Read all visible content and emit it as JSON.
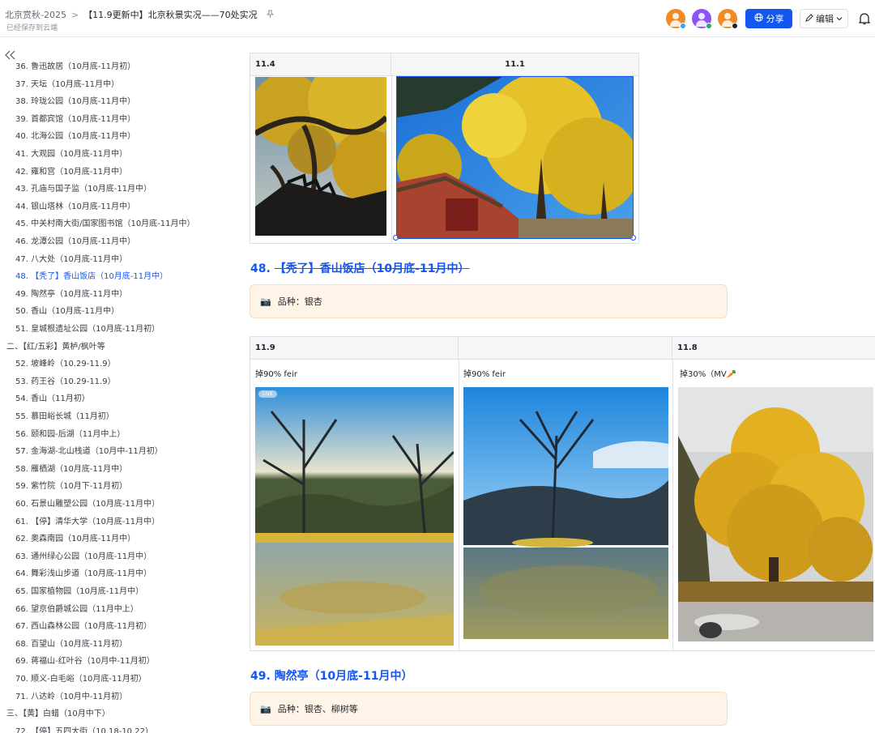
{
  "header": {
    "breadcrumb_root": "北京赏秋-2025",
    "breadcrumb_sep": ">",
    "doc_title": "【11.9更新中】北京秋景实况——70处实况",
    "save_status": "已经保存到云端",
    "share_label": "分享",
    "edit_label": "编辑",
    "avatar_colors": [
      "#f08a24",
      "#8d55f5",
      "#f08a24"
    ],
    "avatar_status_colors": [
      "#3aa1f2",
      "#26a869",
      "#1f2329"
    ],
    "accent": "#1456f0"
  },
  "sidebar": {
    "items": [
      {
        "label": "36. 鲁迅故居（10月底-11月初）",
        "indent": 1,
        "active": false
      },
      {
        "label": "37. 天坛（10月底-11月中）",
        "indent": 1,
        "active": false
      },
      {
        "label": "38. 玲珑公园（10月底-11月中）",
        "indent": 1,
        "active": false
      },
      {
        "label": "39. 首都宾馆（10月底-11月中）",
        "indent": 1,
        "active": false
      },
      {
        "label": "40. 北海公园（10月底-11月中）",
        "indent": 1,
        "active": false
      },
      {
        "label": "41. 大观园（10月底-11月中）",
        "indent": 1,
        "active": false
      },
      {
        "label": "42. 雍和宫（10月底-11月中）",
        "indent": 1,
        "active": false
      },
      {
        "label": "43. 孔庙与国子监（10月底-11月中）",
        "indent": 1,
        "active": false
      },
      {
        "label": "44. 银山塔林（10月底-11月中）",
        "indent": 1,
        "active": false
      },
      {
        "label": "45. 中关村南大街/国家图书馆（10月底-11月中）",
        "indent": 1,
        "active": false
      },
      {
        "label": "46. 龙潭公园（10月底-11月中）",
        "indent": 1,
        "active": false
      },
      {
        "label": "47. 八大处（10月底-11月中）",
        "indent": 1,
        "active": false
      },
      {
        "label": "48. 【秃了】香山饭店（10月底-11月中）",
        "indent": 1,
        "active": true
      },
      {
        "label": "49. 陶然亭（10月底-11月中）",
        "indent": 1,
        "active": false
      },
      {
        "label": "50. 香山（10月底-11月中）",
        "indent": 1,
        "active": false
      },
      {
        "label": "51. 皇城根遗址公园（10月底-11月初）",
        "indent": 1,
        "active": false
      },
      {
        "label": "二、【红/五彩】黄栌/枫叶等",
        "indent": 0,
        "active": false
      },
      {
        "label": "52. 坡峰岭（10.29-11.9）",
        "indent": 1,
        "active": false
      },
      {
        "label": "53. 药王谷（10.29-11.9）",
        "indent": 1,
        "active": false
      },
      {
        "label": "54. 香山（11月初）",
        "indent": 1,
        "active": false
      },
      {
        "label": "55. 慕田峪长城（11月初）",
        "indent": 1,
        "active": false
      },
      {
        "label": "56. 颐和园-后湖（11月中上）",
        "indent": 1,
        "active": false
      },
      {
        "label": "57. 金海湖-北山栈道（10月中-11月初）",
        "indent": 1,
        "active": false
      },
      {
        "label": "58. 雁栖湖（10月底-11月中）",
        "indent": 1,
        "active": false
      },
      {
        "label": "59. 紫竹院（10月下-11月初）",
        "indent": 1,
        "active": false
      },
      {
        "label": "60. 石景山雕塑公园（10月底-11月中）",
        "indent": 1,
        "active": false
      },
      {
        "label": "61. 【停】清华大学（10月底-11月中）",
        "indent": 1,
        "active": false
      },
      {
        "label": "62. 奥森南园（10月底-11月中）",
        "indent": 1,
        "active": false
      },
      {
        "label": "63. 通州绿心公园（10月底-11月中）",
        "indent": 1,
        "active": false
      },
      {
        "label": "64. 舞彩浅山步道（10月底-11月中）",
        "indent": 1,
        "active": false
      },
      {
        "label": "65. 国家植物园（10月底-11月中）",
        "indent": 1,
        "active": false
      },
      {
        "label": "66. 望京伯爵城公园（11月中上）",
        "indent": 1,
        "active": false
      },
      {
        "label": "67. 西山森林公园（10月底-11月初）",
        "indent": 1,
        "active": false
      },
      {
        "label": "68. 百望山（10月底-11月初）",
        "indent": 1,
        "active": false
      },
      {
        "label": "69. 蒋福山-红叶谷（10月中-11月初）",
        "indent": 1,
        "active": false
      },
      {
        "label": "70. 顺义-白毛峪（10月底-11月初）",
        "indent": 1,
        "active": false
      },
      {
        "label": "71. 八达岭（10月中-11月初）",
        "indent": 1,
        "active": false
      },
      {
        "label": "三、【黄】白蜡（10月中下）",
        "indent": 0,
        "active": false
      },
      {
        "label": "72. 【停】五四大街（10.18-10.22）",
        "indent": 1,
        "active": false
      }
    ]
  },
  "main": {
    "table1": {
      "headers": [
        "11.4",
        "11.1"
      ]
    },
    "section48": {
      "number": "48.",
      "title": "【秃了】香山饭店（10月底-11月中）",
      "callout_icon": "📷",
      "callout_text": "品种：银杏"
    },
    "table2": {
      "headers": [
        "11.9",
        "",
        "11.8"
      ],
      "notes": [
        "掉90% feir",
        "掉90% feir",
        "掉30%（MV🥕"
      ],
      "live_badge": "LIVE"
    },
    "section49": {
      "number": "49.",
      "title": "陶然亭（10月底-11月中）",
      "callout_icon": "📷",
      "callout_text": "品种：银杏、柳树等"
    }
  }
}
